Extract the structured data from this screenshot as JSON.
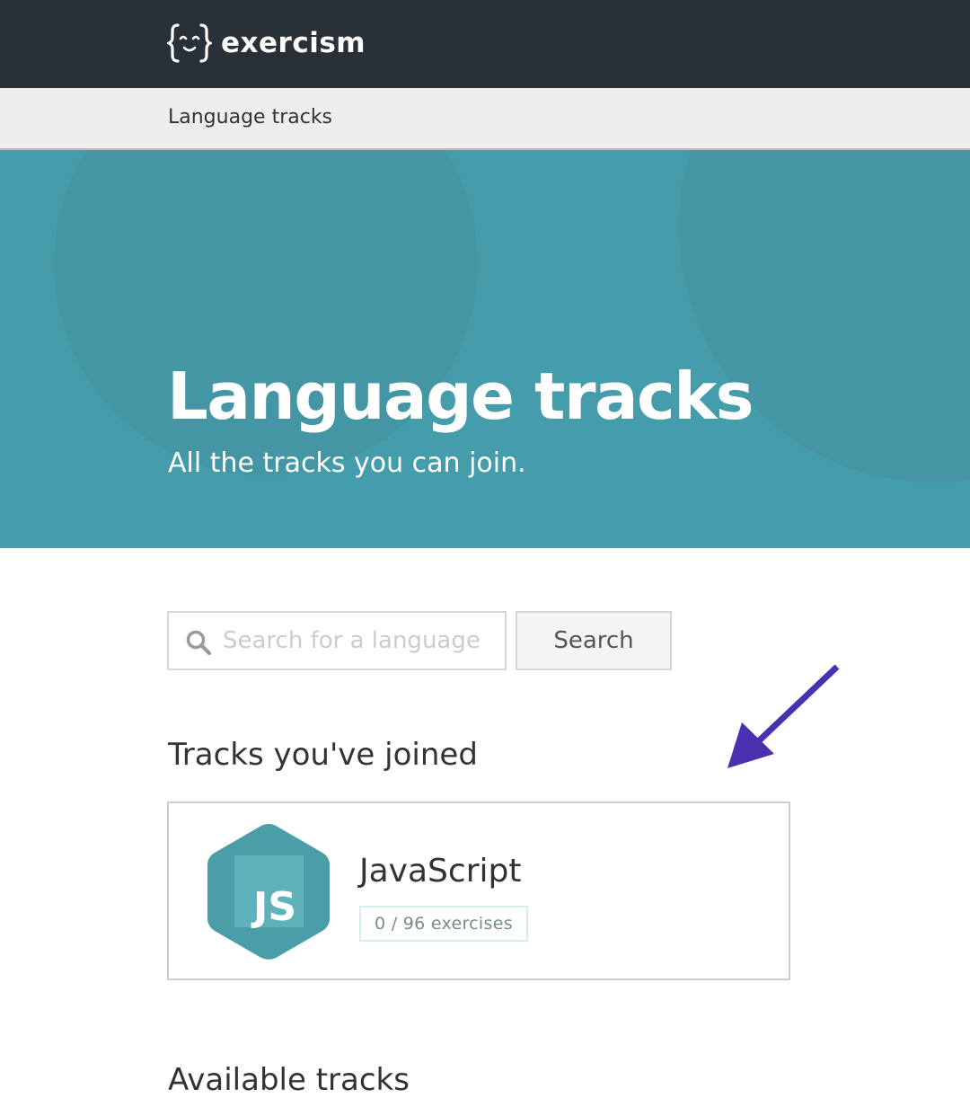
{
  "header": {
    "logo_text": "exercism",
    "logo_icon": "curly-braces-face-icon"
  },
  "breadcrumb": {
    "label": "Language tracks"
  },
  "hero": {
    "title": "Language tracks",
    "subtitle": "All the tracks you can join."
  },
  "search": {
    "placeholder": "Search for a language",
    "value": "",
    "button_label": "Search",
    "icon": "search-icon"
  },
  "joined": {
    "heading": "Tracks you've joined",
    "tracks": [
      {
        "name": "JavaScript",
        "icon_text": "JS",
        "progress_label": "0 / 96 exercises",
        "completed": 0,
        "total": 96
      }
    ]
  },
  "available": {
    "heading": "Available tracks"
  },
  "colors": {
    "header_bg": "#283038",
    "hero_bg": "#459caa",
    "track_accent": "#4a9ea8",
    "annotation_arrow": "#4a2fb0"
  }
}
